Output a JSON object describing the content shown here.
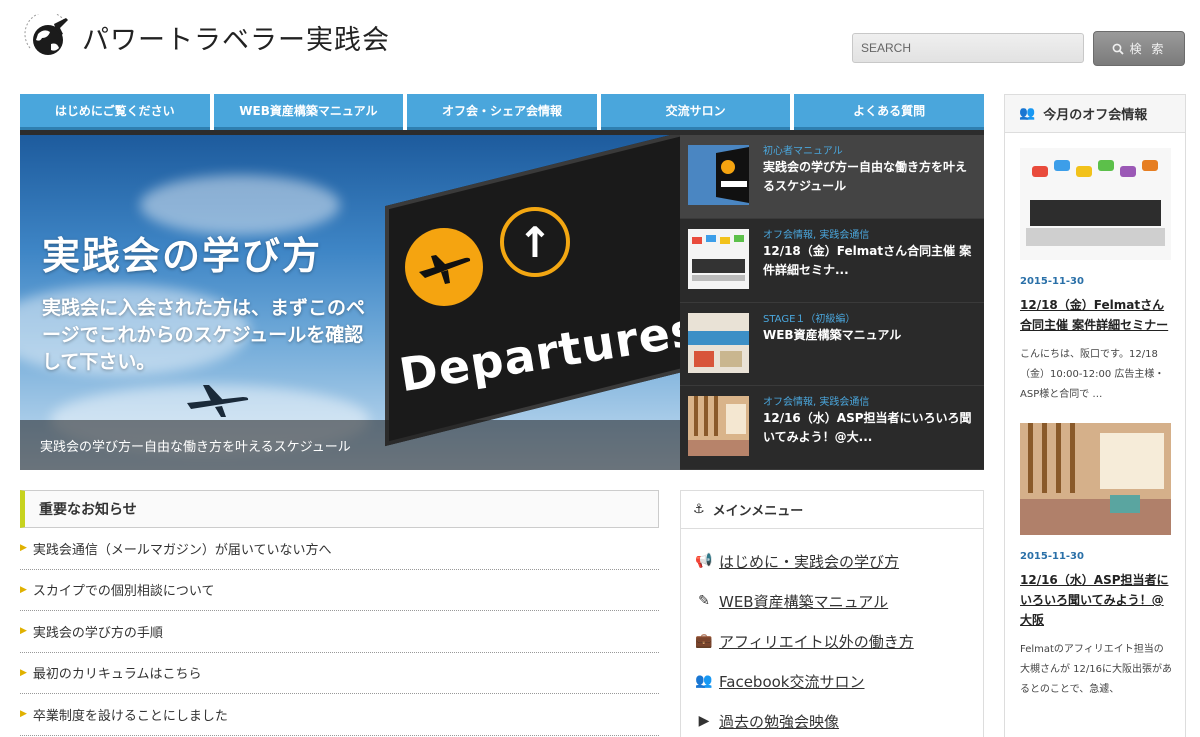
{
  "site": {
    "title": "パワートラベラー実践会",
    "logo_icon": "globe-plane-icon"
  },
  "search": {
    "placeholder": "SEARCH",
    "button_label": "検 索",
    "button_icon": "search-icon"
  },
  "nav": {
    "items": [
      {
        "label": "はじめにご覧ください"
      },
      {
        "label": "WEB資産構築マニュアル"
      },
      {
        "label": "オフ会・シェア会情報"
      },
      {
        "label": "交流サロン"
      },
      {
        "label": "よくある質問"
      }
    ],
    "color": "#4aa6dc"
  },
  "hero": {
    "title": "実践会の学び方",
    "subtitle": "実践会に入会された方は、まずこのページでこれからのスケジュールを確認して下さい。",
    "sign_word": "Departures",
    "caption": "実践会の学び方ー自由な働き方を叶えるスケジュール"
  },
  "slider": [
    {
      "category": "初心者マニュアル",
      "title": "実践会の学び方ー自由な働き方を叶えるスケジュール"
    },
    {
      "category": "オフ会情報, 実践会通信",
      "title": "12/18（金）Felmatさん合同主催 案件詳細セミナ..."
    },
    {
      "category": "STAGE１（初級編）",
      "title": "WEB資産構築マニュアル"
    },
    {
      "category": "オフ会情報, 実践会通信",
      "title": "12/16（水）ASP担当者にいろいろ聞いてみよう！@大..."
    }
  ],
  "notices": {
    "heading": "重要なお知らせ",
    "items": [
      "実践会通信（メールマガジン）が届いていない方へ",
      "スカイプでの個別相談について",
      "実践会の学び方の手順",
      "最初のカリキュラムはこちら",
      "卒業制度を設けることにしました"
    ]
  },
  "main_menu": {
    "heading": "メインメニュー",
    "heading_icon": "anchor-icon",
    "items": [
      {
        "icon": "megaphone-icon",
        "label": "はじめに・実践会の学び方"
      },
      {
        "icon": "edit-icon",
        "label": "WEB資産構築マニュアル"
      },
      {
        "icon": "briefcase-icon",
        "label": "アフィリエイト以外の働き方"
      },
      {
        "icon": "users-icon",
        "label": "Facebook交流サロン"
      },
      {
        "icon": "video-icon",
        "label": "過去の勉強会映像"
      }
    ]
  },
  "sidebar": {
    "heading": "今月のオフ会情報",
    "heading_icon": "users-icon",
    "posts": [
      {
        "date": "2015-11-30",
        "title": "12/18（金）Felmatさん合同主催 案件詳細セミナー",
        "excerpt": "こんにちは、阪口です。12/18（金）10:00-12:00 広告主様・ASP様と合同で …"
      },
      {
        "date": "2015-11-30",
        "title": "12/16（水）ASP担当者にいろいろ聞いてみよう！@大阪",
        "excerpt": "Felmatのアフィリエイト担当の大槻さんが 12/16に大阪出張があるとのことで、急遽、"
      }
    ]
  }
}
